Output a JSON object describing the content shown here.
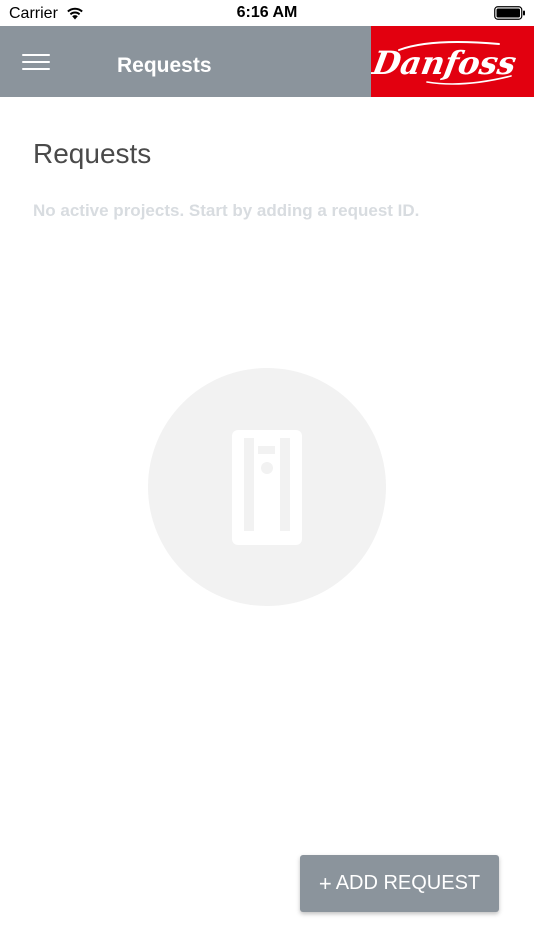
{
  "status_bar": {
    "carrier": "Carrier",
    "time": "6:16 AM",
    "wifi_icon": "wifi-icon",
    "battery_icon": "battery-full-icon"
  },
  "header": {
    "title": "Requests",
    "menu_icon": "hamburger-menu-icon",
    "logo_text": "Danfoss",
    "logo_color": "#e2000f",
    "background_color": "#8b949c"
  },
  "main": {
    "page_title": "Requests",
    "empty_message": "No active projects. Start by adding a request ID.",
    "illustration_icon": "drive-device-icon"
  },
  "actions": {
    "add_request_icon": "+",
    "add_request_label": "ADD REQUEST"
  }
}
